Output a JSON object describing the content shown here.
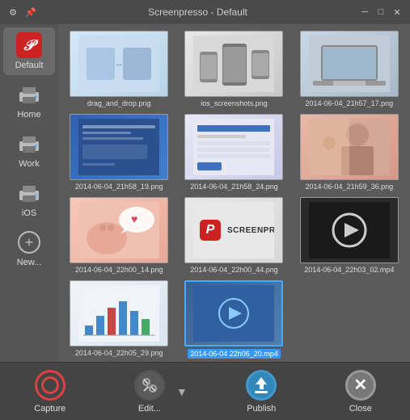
{
  "titleBar": {
    "title": "Screenpresso  -  Default",
    "settingsIcon": "gear-icon",
    "pinIcon": "pin-icon",
    "minimizeIcon": "minimize-icon",
    "closeIcon": "close-icon"
  },
  "sidebar": {
    "items": [
      {
        "id": "default",
        "label": "Default",
        "icon": "p-logo-icon",
        "active": true
      },
      {
        "id": "home",
        "label": "Home",
        "icon": "printer-icon"
      },
      {
        "id": "work",
        "label": "Work",
        "icon": "printer-icon"
      },
      {
        "id": "ios",
        "label": "iOS",
        "icon": "printer-icon"
      },
      {
        "id": "new",
        "label": "New...",
        "icon": "plus-icon"
      }
    ]
  },
  "thumbnails": [
    {
      "id": 1,
      "label": "drag_and_drop.png",
      "type": "dnd",
      "selected": false
    },
    {
      "id": 2,
      "label": "ios_screenshots.png",
      "type": "ios",
      "selected": false
    },
    {
      "id": 3,
      "label": "2014-06-04_21h57_17.png",
      "type": "laptop",
      "selected": false
    },
    {
      "id": 4,
      "label": "2014-06-04_21h58_19.png",
      "type": "blue-screen",
      "selected": false
    },
    {
      "id": 5,
      "label": "2014-06-04_21h58_24.png",
      "type": "form",
      "selected": false
    },
    {
      "id": 6,
      "label": "2014-06-04_21h59_36.png",
      "type": "girl",
      "selected": false
    },
    {
      "id": 7,
      "label": "2014-06-04_22h00_14.png",
      "type": "cat",
      "selected": false
    },
    {
      "id": 8,
      "label": "2014-06-04_22h00_44.png",
      "type": "screenpresso",
      "selected": false
    },
    {
      "id": 9,
      "label": "2014-06-04_22h03_02.mp4",
      "type": "video1",
      "selected": false
    },
    {
      "id": 10,
      "label": "2014-06-04_22h05_29.png",
      "type": "chart",
      "selected": false
    },
    {
      "id": 11,
      "label": "2014-06-04 22h06_20.mp4",
      "type": "video2",
      "selected": true
    }
  ],
  "toolbar": {
    "capture": {
      "label": "Capture"
    },
    "edit": {
      "label": "Edit..."
    },
    "publish": {
      "label": "Publish"
    },
    "close": {
      "label": "Close"
    }
  }
}
